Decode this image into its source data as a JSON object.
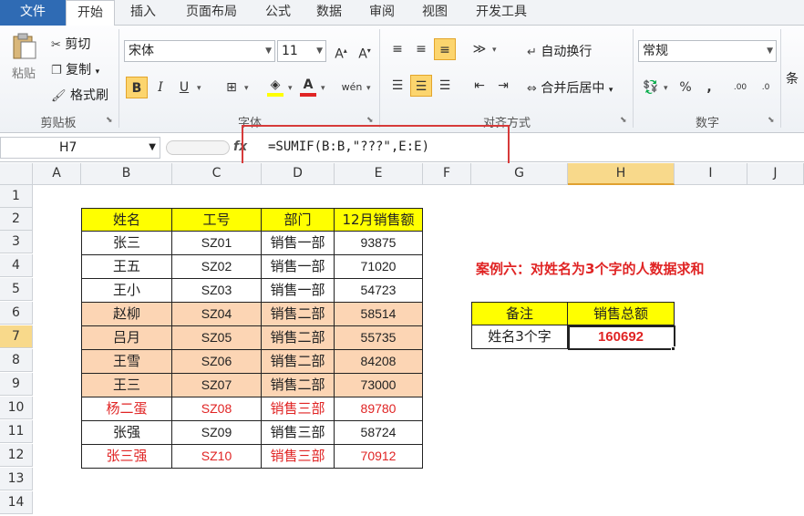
{
  "ribbon": {
    "tabs": [
      "文件",
      "开始",
      "插入",
      "页面布局",
      "公式",
      "数据",
      "审阅",
      "视图",
      "开发工具"
    ],
    "clipboard": {
      "paste": "粘贴",
      "cut": "剪切",
      "copy": "复制",
      "format_painter": "格式刷",
      "label": "剪贴板"
    },
    "font": {
      "name": "宋体",
      "size": "11",
      "label": "字体",
      "bold": "B",
      "italic": "I",
      "underline": "U"
    },
    "alignment": {
      "wrap": "自动换行",
      "merge": "合并后居中",
      "label": "对齐方式"
    },
    "number": {
      "format": "常规",
      "label": "数字",
      "percent": "%"
    },
    "styles_partial": "条"
  },
  "formula_bar": {
    "name_box": "H7",
    "fx": "fx",
    "formula": "=SUMIF(B:B,\"???\",E:E)"
  },
  "columns": [
    "A",
    "B",
    "C",
    "D",
    "E",
    "F",
    "G",
    "H",
    "I",
    "J"
  ],
  "rows": [
    "1",
    "2",
    "3",
    "4",
    "5",
    "6",
    "7",
    "8",
    "9",
    "10",
    "11",
    "12",
    "13",
    "14"
  ],
  "table": {
    "headers": [
      "姓名",
      "工号",
      "部门",
      "12月销售额"
    ],
    "rows": [
      {
        "name": "张三",
        "id": "SZ01",
        "dept": "销售一部",
        "sales": "93875"
      },
      {
        "name": "王五",
        "id": "SZ02",
        "dept": "销售一部",
        "sales": "71020"
      },
      {
        "name": "王小",
        "id": "SZ03",
        "dept": "销售一部",
        "sales": "54723"
      },
      {
        "name": "赵柳",
        "id": "SZ04",
        "dept": "销售二部",
        "sales": "58514"
      },
      {
        "name": "吕月",
        "id": "SZ05",
        "dept": "销售二部",
        "sales": "55735"
      },
      {
        "name": "王雪",
        "id": "SZ06",
        "dept": "销售二部",
        "sales": "84208"
      },
      {
        "name": "王三",
        "id": "SZ07",
        "dept": "销售二部",
        "sales": "73000"
      },
      {
        "name": "杨二蛋",
        "id": "SZ08",
        "dept": "销售三部",
        "sales": "89780"
      },
      {
        "name": "张强",
        "id": "SZ09",
        "dept": "销售三部",
        "sales": "58724"
      },
      {
        "name": "张三强",
        "id": "SZ10",
        "dept": "销售三部",
        "sales": "70912"
      }
    ]
  },
  "case_title": "案例六：对姓名为3个字的人数据求和",
  "summary": {
    "header_note": "备注",
    "header_total": "销售总额",
    "note": "姓名3个字",
    "total": "160692"
  },
  "colors": {
    "header_fill": "#ffff00",
    "peach_fill": "#fcd5b4",
    "red_text": "#e02424",
    "highlight_box": "#d63a3a"
  }
}
